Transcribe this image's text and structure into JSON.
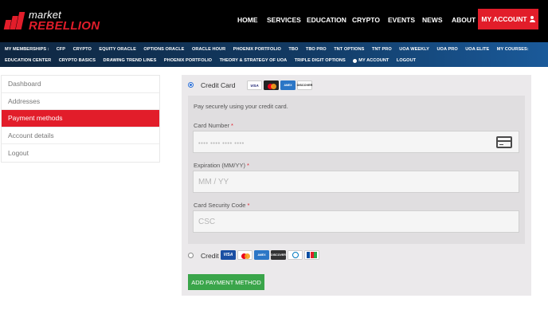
{
  "brand": {
    "top": "market",
    "bottom": "REBELLION"
  },
  "nav": {
    "home": "HOME",
    "services": "SERVICES",
    "education": "EDUCATION",
    "crypto": "CRYPTO",
    "events": "EVENTS",
    "news": "NEWS",
    "about": "ABOUT",
    "my_account": "MY ACCOUNT",
    "accent_color": "#e21d2a"
  },
  "memberships": {
    "lead": "MY MEMBERSHIPS :",
    "row1": [
      "CFP",
      "CRYPTO",
      "EQUITY ORACLE",
      "OPTIONS ORACLE",
      "ORACLE HOUR",
      "PHOENIX PORTFOLIO",
      "TBO",
      "TBO PRO",
      "TNT OPTIONS",
      "TNT PRO",
      "UOA WEEKLY",
      "UOA PRO",
      "UOA ELITE",
      "MY COURSES:"
    ],
    "row2": [
      "EDUCATION CENTER",
      "CRYPTO BASICS",
      "DRAWING TREND LINES",
      "PHOENIX PORTFOLIO",
      "THEORY & STRATEGY OF UOA",
      "TRIPLE DIGIT OPTIONS"
    ],
    "my_account": "MY ACCOUNT",
    "logout": "LOGOUT"
  },
  "sidebar": {
    "items": [
      {
        "label": "Dashboard",
        "active": false
      },
      {
        "label": "Addresses",
        "active": false
      },
      {
        "label": "Payment methods",
        "active": true
      },
      {
        "label": "Account details",
        "active": false
      },
      {
        "label": "Logout",
        "active": false
      }
    ]
  },
  "payment": {
    "option1": {
      "label": "Credit Card",
      "selected": true,
      "cards": [
        "VISA",
        "MasterCard",
        "AMEX",
        "DISCOVER"
      ]
    },
    "secure_text": "Pay securely using your credit card.",
    "card_number": {
      "label": "Card Number",
      "required": "*",
      "placeholder": "•••• •••• •••• ••••"
    },
    "expiration": {
      "label": "Expiration (MM/YY)",
      "required": "*",
      "placeholder": "MM / YY"
    },
    "csc": {
      "label": "Card Security Code",
      "required": "*",
      "placeholder": "CSC"
    },
    "option2": {
      "label": "Credit",
      "selected": false,
      "cards": [
        "VISA",
        "MasterCard",
        "AMEX",
        "DISCOVER",
        "Diners Club",
        "JCB"
      ]
    },
    "add_button": "ADD PAYMENT METHOD",
    "button_color": "#3aa54a"
  }
}
